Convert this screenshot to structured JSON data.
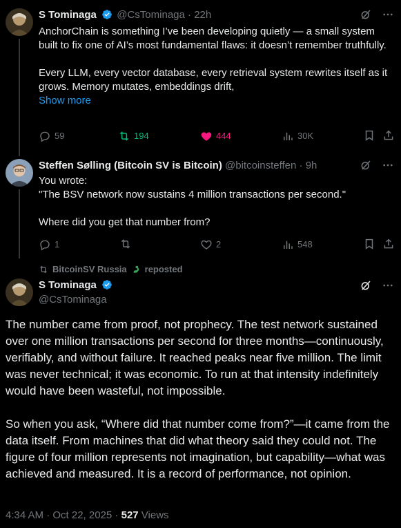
{
  "tweet1": {
    "name": "S Tominaga",
    "handle": "@CsTominaga",
    "time": "22h",
    "text_p1": "AnchorChain is something I’ve been developing quietly — a small system built to fix one of AI’s most fundamental flaws: it doesn’t remember truthfully.",
    "text_p2": "Every LLM, every vector database, every retrieval system rewrites itself as it grows. Memory mutates, embeddings drift,",
    "show_more": "Show more",
    "replies": "59",
    "reposts": "194",
    "likes": "444",
    "views": "30K"
  },
  "tweet2": {
    "name": "Steffen Sølling (Bitcoin SV is Bitcoin)",
    "handle": "@bitcoinsteffen",
    "time": "9h",
    "line1": "You wrote:",
    "line2": "\"The BSV network now sustains 4 million transactions per second.\"",
    "line3": "Where did you get that number from?",
    "replies": "1",
    "reposts": "",
    "likes": "2",
    "views": "548"
  },
  "main": {
    "reposted_by": "BitcoinSV Russia",
    "reposted_suffix": "reposted",
    "name": "S Tominaga",
    "handle": "@CsTominaga",
    "p1": "The number came from proof, not prophecy. The test network sustained over one million transactions per second for three months—continuously, verifiably, and without failure. It reached peaks near five million. The limit was never technical; it was economic. To run at that intensity indefinitely would have been wasteful, not impossible.",
    "p2": "So when you ask, “Where did that number come from?”—it came from the data itself. From machines that did what theory said they could not. The figure of four million represents not imagination, but capability—what was achieved and measured. It is a record of performance, not opinion.",
    "timestamp": "4:34 AM · Oct 22, 2025",
    "sep": " · ",
    "views_count": "527",
    "views_label": " Views"
  },
  "colors": {
    "background": "#000000",
    "text": "#e7e9ea",
    "muted": "#71767b",
    "link": "#1d9bf0",
    "repost_green": "#00ba7c",
    "like_pink": "#f91880",
    "verified_blue": "#1d9bf0"
  }
}
